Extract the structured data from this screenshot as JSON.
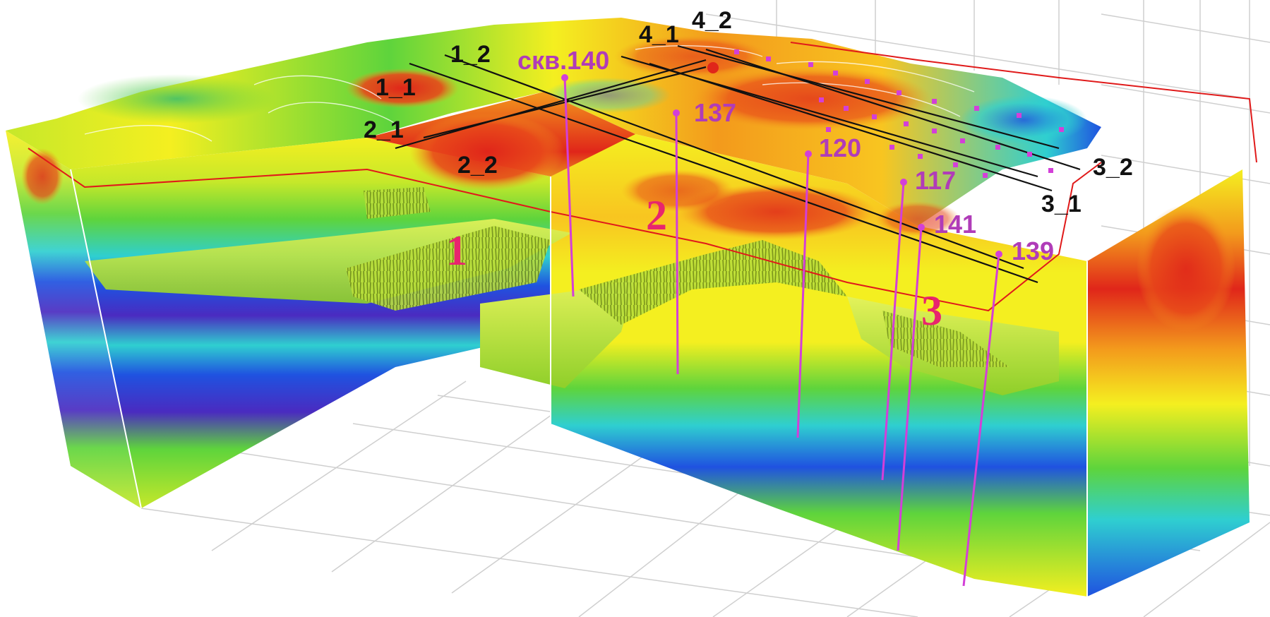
{
  "profile_lines": [
    {
      "label": "1_1"
    },
    {
      "label": "1_2"
    },
    {
      "label": "2_1"
    },
    {
      "label": "2_2"
    },
    {
      "label": "4_1"
    },
    {
      "label": "4_2"
    },
    {
      "label": "3_1"
    },
    {
      "label": "3_2"
    }
  ],
  "wells": [
    {
      "label": "скв.140"
    },
    {
      "label": "137"
    },
    {
      "label": "120"
    },
    {
      "label": "117"
    },
    {
      "label": "141"
    },
    {
      "label": "139"
    }
  ],
  "zones": [
    {
      "label": "1"
    },
    {
      "label": "2"
    },
    {
      "label": "3"
    }
  ],
  "colors": {
    "red": "#e0261a",
    "orange": "#f39a1c",
    "yellow": "#f4ef20",
    "green": "#5ed43c",
    "cyan": "#2fcfd0",
    "blue": "#1f52e0",
    "violet": "#4a2bc0",
    "well": "#d33fd8",
    "zone_label": "#e8256e"
  }
}
